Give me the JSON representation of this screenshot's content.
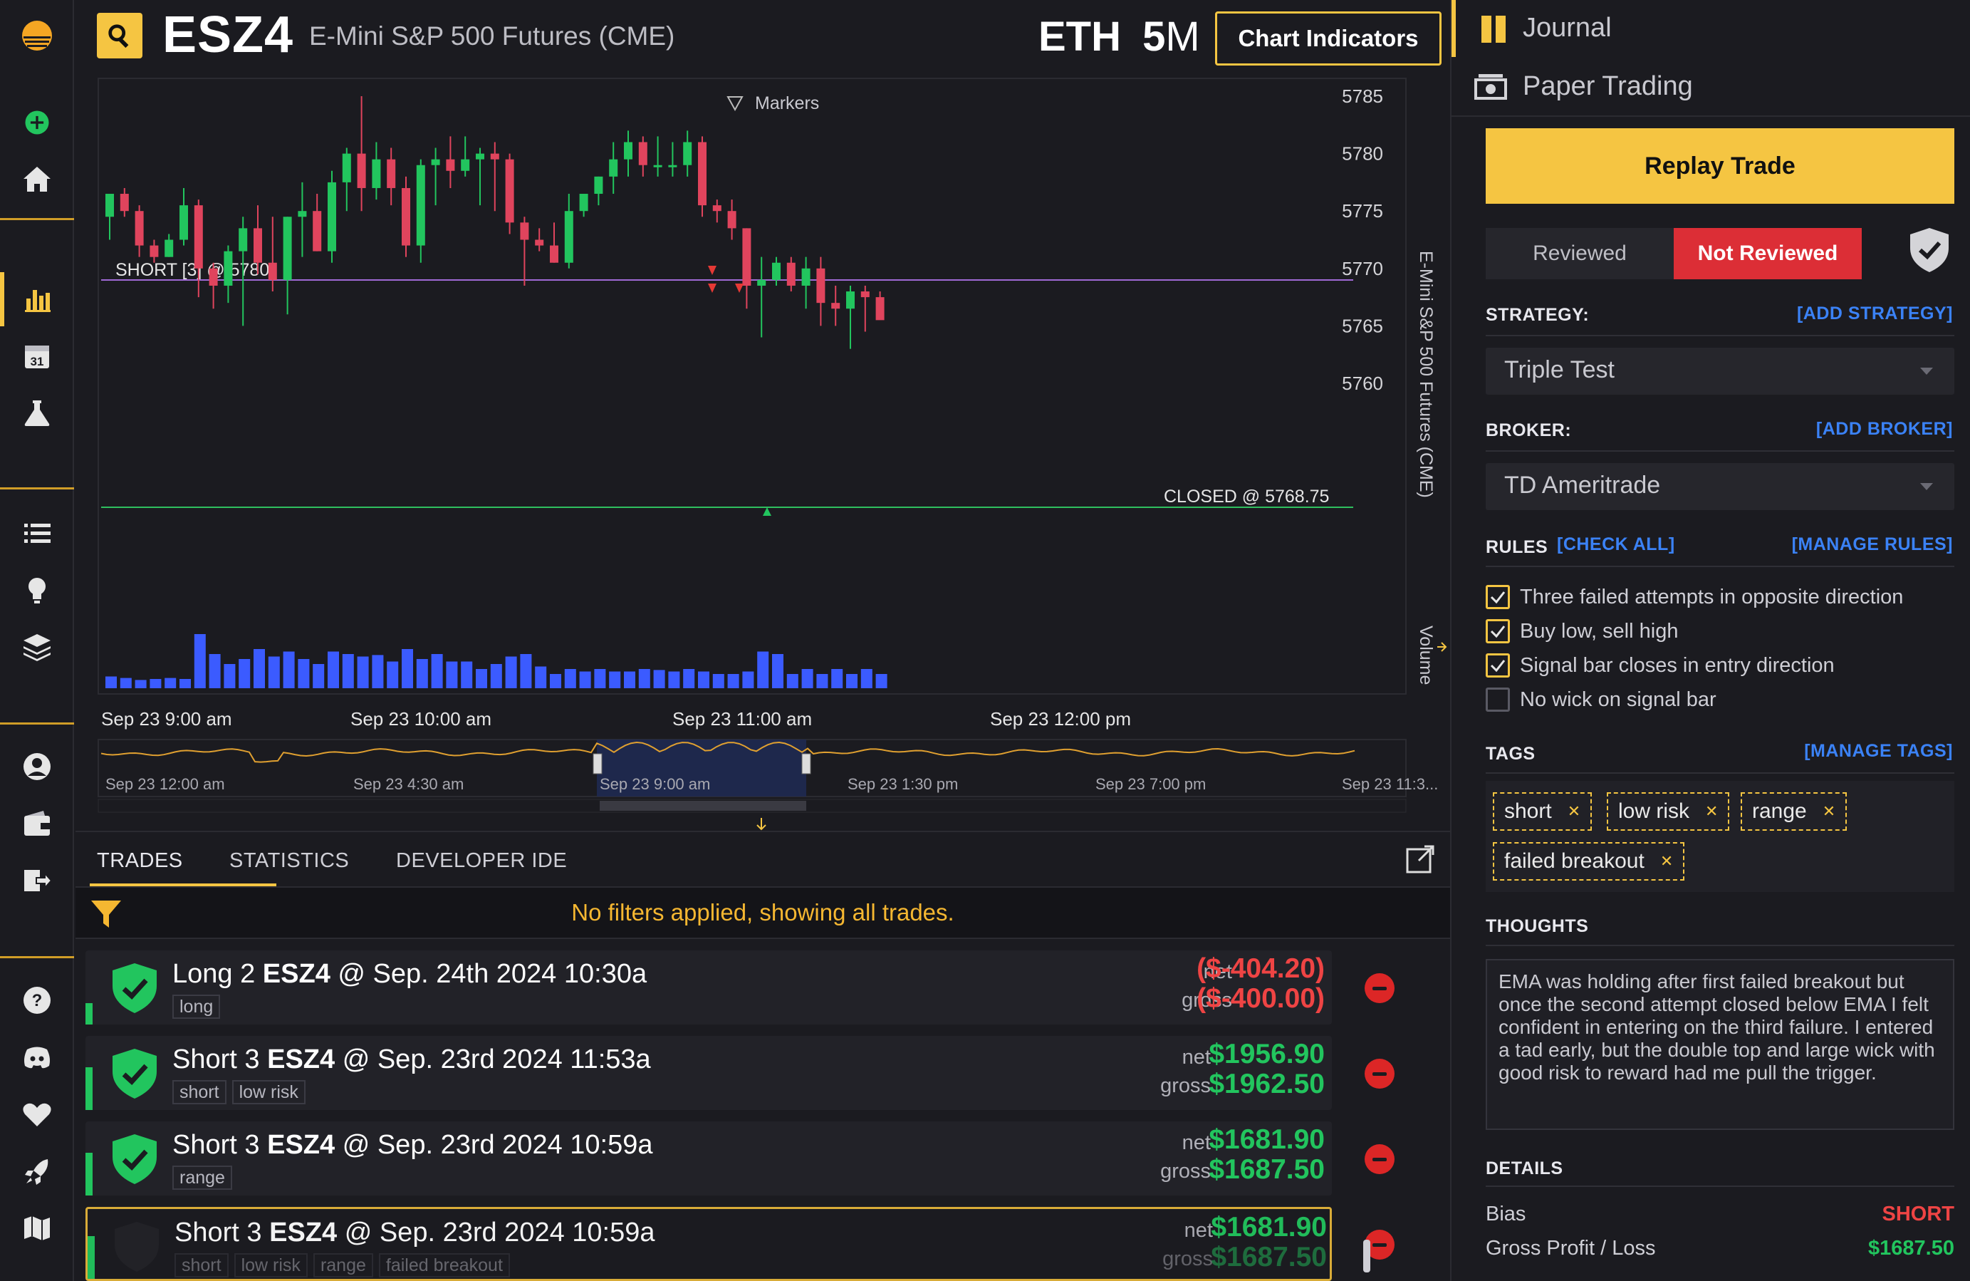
{
  "header": {
    "ticker": "ESZ4",
    "ticker_name": "E-Mini S&P 500 Futures (CME)",
    "session": "ETH",
    "timeframe_num": "5",
    "timeframe_unit": "M",
    "chart_indicators_label": "Chart Indicators"
  },
  "chart": {
    "markers_label": "Markers",
    "short_label": "SHORT [3] @ 5780",
    "closed_label": "CLOSED @ 5768.75",
    "side_label": "E-Mini S&P 500 Futures (CME)",
    "volume_label": "Volume",
    "y_ticks": [
      "5785",
      "5780",
      "5775",
      "5770",
      "5765",
      "5760"
    ],
    "x_ticks": [
      "Sep 23 9:00 am",
      "Sep 23 10:00 am",
      "Sep 23 11:00 am",
      "Sep 23 12:00 pm"
    ],
    "nav_ticks": [
      "Sep 23 12:00 am",
      "Sep 23 4:30 am",
      "Sep 23 9:00 am",
      "Sep 23 1:30 pm",
      "Sep 23 7:00 pm",
      "Sep 23 11:3..."
    ],
    "colors": {
      "up": "#22c55e",
      "down": "#e0445d",
      "volume": "#3b5bff",
      "short_line": "#a06ad6",
      "closed_line": "#2fbf5f"
    }
  },
  "chart_data": {
    "type": "candlestick",
    "ylim": [
      5758,
      5788
    ],
    "short_entry": 5780,
    "closed_at": 5768.75,
    "candles": [
      {
        "o": 5774.5,
        "h": 5776.0,
        "l": 5772.5,
        "c": 5776.5
      },
      {
        "o": 5776.5,
        "h": 5777.0,
        "l": 5774.5,
        "c": 5775.0
      },
      {
        "o": 5775.0,
        "h": 5775.5,
        "l": 5771.0,
        "c": 5772.0
      },
      {
        "o": 5772.0,
        "h": 5772.5,
        "l": 5770.5,
        "c": 5771.0
      },
      {
        "o": 5771.0,
        "h": 5773.0,
        "l": 5771.0,
        "c": 5772.5
      },
      {
        "o": 5772.5,
        "h": 5777.0,
        "l": 5772.0,
        "c": 5775.5
      },
      {
        "o": 5775.5,
        "h": 5776.0,
        "l": 5767.5,
        "c": 5770.0
      },
      {
        "o": 5770.0,
        "h": 5770.5,
        "l": 5766.5,
        "c": 5768.5
      },
      {
        "o": 5768.5,
        "h": 5772.0,
        "l": 5767.0,
        "c": 5771.5
      },
      {
        "o": 5771.5,
        "h": 5774.5,
        "l": 5765.0,
        "c": 5773.5
      },
      {
        "o": 5773.5,
        "h": 5775.5,
        "l": 5769.5,
        "c": 5770.5
      },
      {
        "o": 5770.5,
        "h": 5774.5,
        "l": 5768.0,
        "c": 5769.0
      },
      {
        "o": 5769.0,
        "h": 5774.5,
        "l": 5766.0,
        "c": 5774.5
      },
      {
        "o": 5774.5,
        "h": 5777.5,
        "l": 5771.0,
        "c": 5775.0
      },
      {
        "o": 5775.0,
        "h": 5776.5,
        "l": 5771.5,
        "c": 5771.5
      },
      {
        "o": 5771.5,
        "h": 5778.5,
        "l": 5770.5,
        "c": 5777.5
      },
      {
        "o": 5777.5,
        "h": 5780.5,
        "l": 5775.0,
        "c": 5780.0
      },
      {
        "o": 5780.0,
        "h": 5785.0,
        "l": 5775.0,
        "c": 5777.0
      },
      {
        "o": 5777.0,
        "h": 5781.0,
        "l": 5776.0,
        "c": 5779.5
      },
      {
        "o": 5779.5,
        "h": 5780.5,
        "l": 5775.5,
        "c": 5777.0
      },
      {
        "o": 5777.0,
        "h": 5778.0,
        "l": 5771.0,
        "c": 5772.0
      },
      {
        "o": 5772.0,
        "h": 5779.5,
        "l": 5770.5,
        "c": 5779.0
      },
      {
        "o": 5779.0,
        "h": 5780.5,
        "l": 5775.5,
        "c": 5779.5
      },
      {
        "o": 5779.5,
        "h": 5781.5,
        "l": 5777.0,
        "c": 5778.5
      },
      {
        "o": 5778.5,
        "h": 5781.5,
        "l": 5778.0,
        "c": 5779.5
      },
      {
        "o": 5779.5,
        "h": 5780.5,
        "l": 5775.5,
        "c": 5780.0
      },
      {
        "o": 5780.0,
        "h": 5781.0,
        "l": 5775.0,
        "c": 5779.5
      },
      {
        "o": 5779.5,
        "h": 5780.0,
        "l": 5773.0,
        "c": 5774.0
      },
      {
        "o": 5774.0,
        "h": 5774.5,
        "l": 5768.5,
        "c": 5772.5
      },
      {
        "o": 5772.5,
        "h": 5773.5,
        "l": 5771.5,
        "c": 5772.0
      },
      {
        "o": 5772.0,
        "h": 5774.0,
        "l": 5770.5,
        "c": 5770.5
      },
      {
        "o": 5770.5,
        "h": 5776.5,
        "l": 5770.0,
        "c": 5775.0
      },
      {
        "o": 5775.0,
        "h": 5776.5,
        "l": 5774.5,
        "c": 5776.5
      },
      {
        "o": 5776.5,
        "h": 5778.0,
        "l": 5775.5,
        "c": 5778.0
      },
      {
        "o": 5778.0,
        "h": 5781.0,
        "l": 5776.5,
        "c": 5779.5
      },
      {
        "o": 5779.5,
        "h": 5782.0,
        "l": 5778.0,
        "c": 5781.0
      },
      {
        "o": 5781.0,
        "h": 5781.5,
        "l": 5778.0,
        "c": 5779.0
      },
      {
        "o": 5779.0,
        "h": 5781.5,
        "l": 5778.0,
        "c": 5779.0
      },
      {
        "o": 5779.0,
        "h": 5781.0,
        "l": 5778.0,
        "c": 5779.0
      },
      {
        "o": 5779.0,
        "h": 5782.0,
        "l": 5778.0,
        "c": 5781.0
      },
      {
        "o": 5781.0,
        "h": 5781.5,
        "l": 5774.5,
        "c": 5775.5
      },
      {
        "o": 5775.5,
        "h": 5776.0,
        "l": 5774.0,
        "c": 5775.0
      },
      {
        "o": 5775.0,
        "h": 5776.0,
        "l": 5772.5,
        "c": 5773.5
      },
      {
        "o": 5773.5,
        "h": 5773.5,
        "l": 5766.5,
        "c": 5768.5
      },
      {
        "o": 5768.5,
        "h": 5771.0,
        "l": 5764.0,
        "c": 5769.0
      },
      {
        "o": 5769.0,
        "h": 5771.0,
        "l": 5768.5,
        "c": 5770.5
      },
      {
        "o": 5770.5,
        "h": 5771.0,
        "l": 5768.0,
        "c": 5768.5
      },
      {
        "o": 5768.5,
        "h": 5771.0,
        "l": 5766.5,
        "c": 5770.0
      },
      {
        "o": 5770.0,
        "h": 5771.0,
        "l": 5765.0,
        "c": 5767.0
      },
      {
        "o": 5767.0,
        "h": 5768.5,
        "l": 5765.0,
        "c": 5766.5
      },
      {
        "o": 5766.5,
        "h": 5768.5,
        "l": 5763.0,
        "c": 5768.0
      },
      {
        "o": 5768.0,
        "h": 5768.5,
        "l": 5764.5,
        "c": 5767.5
      },
      {
        "o": 5767.5,
        "h": 5768.0,
        "l": 5766.0,
        "c": 5765.5
      }
    ],
    "volume_rel": [
      0.15,
      0.12,
      0.08,
      0.1,
      0.12,
      0.1,
      1.0,
      0.6,
      0.4,
      0.5,
      0.7,
      0.55,
      0.65,
      0.5,
      0.4,
      0.65,
      0.6,
      0.55,
      0.58,
      0.45,
      0.7,
      0.5,
      0.6,
      0.45,
      0.45,
      0.3,
      0.4,
      0.55,
      0.6,
      0.35,
      0.2,
      0.3,
      0.25,
      0.3,
      0.25,
      0.25,
      0.3,
      0.28,
      0.25,
      0.3,
      0.25,
      0.2,
      0.2,
      0.25,
      0.65,
      0.6,
      0.2,
      0.3,
      0.2,
      0.3,
      0.2,
      0.3,
      0.2
    ]
  },
  "tabs": [
    "TRADES",
    "STATISTICS",
    "DEVELOPER IDE"
  ],
  "filter_msg": "No filters applied, showing all trades.",
  "trades": [
    {
      "dir": "Long 2",
      "ticker": "ESZ4",
      "at": "@ Sep. 24th 2024 10:30a",
      "tags": [
        "long"
      ],
      "net_label": "net",
      "gross_label": "gross",
      "net": "($-404.20)",
      "gross": "($-400.00)",
      "sign": "neg"
    },
    {
      "dir": "Short 3",
      "ticker": "ESZ4",
      "at": "@ Sep. 23rd 2024 11:53a",
      "tags": [
        "short",
        "low risk"
      ],
      "net_label": "net",
      "gross_label": "gross",
      "net": "$1956.90",
      "gross": "$1962.50",
      "sign": "pos"
    },
    {
      "dir": "Short 3",
      "ticker": "ESZ4",
      "at": "@ Sep. 23rd 2024 10:59a",
      "tags": [
        "range"
      ],
      "net_label": "net",
      "gross_label": "gross",
      "net": "$1681.90",
      "gross": "$1687.50",
      "sign": "pos"
    },
    {
      "dir": "Short 3",
      "ticker": "ESZ4",
      "at": "@ Sep. 23rd 2024 10:59a",
      "tags": [
        "short",
        "low risk",
        "range",
        "failed breakout"
      ],
      "net_label": "net",
      "gross_label": "gross",
      "net": "$1681.90",
      "gross": "$1687.50",
      "sign": "pos"
    }
  ],
  "panel": {
    "journal": "Journal",
    "paper": "Paper Trading",
    "replay": "Replay Trade",
    "reviewed": "Reviewed",
    "not_reviewed": "Not Reviewed",
    "strategy_label": "STRATEGY:",
    "add_strategy": "[ADD STRATEGY]",
    "strategy_value": "Triple Test",
    "broker_label": "BROKER:",
    "add_broker": "[ADD BROKER]",
    "broker_value": "TD Ameritrade",
    "rules_label": "RULES",
    "check_all": "[CHECK ALL]",
    "manage_rules": "[MANAGE RULES]",
    "rules": [
      {
        "text": "Three failed attempts in opposite direction",
        "checked": true
      },
      {
        "text": "Buy low, sell high",
        "checked": true
      },
      {
        "text": "Signal bar closes in entry direction",
        "checked": true
      },
      {
        "text": "No wick on signal bar",
        "checked": false
      }
    ],
    "tags_label": "TAGS",
    "manage_tags": "[MANAGE TAGS]",
    "tags": [
      "short",
      "low risk",
      "range",
      "failed breakout"
    ],
    "thoughts_label": "THOUGHTS",
    "thoughts": "EMA was holding after first failed breakout but once the second attempt closed below EMA I felt confident in entering on the third failure. I entered a tad early, but the double top and large wick with good risk to reward had me pull the trigger.",
    "details_label": "DETAILS",
    "bias_label": "Bias",
    "bias_value": "SHORT",
    "gpl_label": "Gross Profit / Loss",
    "gpl_value": "$1687.50"
  }
}
